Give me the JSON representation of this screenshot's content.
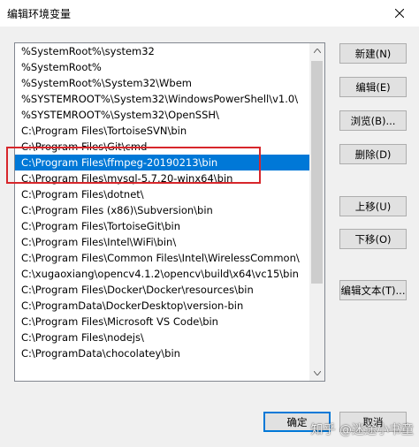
{
  "window": {
    "title": "编辑环境变量"
  },
  "list": {
    "items": [
      "%SystemRoot%\\system32",
      "%SystemRoot%",
      "%SystemRoot%\\System32\\Wbem",
      "%SYSTEMROOT%\\System32\\WindowsPowerShell\\v1.0\\",
      "%SYSTEMROOT%\\System32\\OpenSSH\\",
      "C:\\Program Files\\TortoiseSVN\\bin",
      "C:\\Program Files\\Git\\cmd",
      "C:\\Program Files\\ffmpeg-20190213\\bin",
      "C:\\Program Files\\mysql-5.7.20-winx64\\bin",
      "C:\\Program Files\\dotnet\\",
      "C:\\Program Files (x86)\\Subversion\\bin",
      "C:\\Program Files\\TortoiseGit\\bin",
      "C:\\Program Files\\Intel\\WiFi\\bin\\",
      "C:\\Program Files\\Common Files\\Intel\\WirelessCommon\\",
      "C:\\xugaoxiang\\opencv4.1.2\\opencv\\build\\x64\\vc15\\bin",
      "C:\\Program Files\\Docker\\Docker\\resources\\bin",
      "C:\\ProgramData\\DockerDesktop\\version-bin",
      "C:\\Program Files\\Microsoft VS Code\\bin",
      "C:\\Program Files\\nodejs\\",
      "C:\\ProgramData\\chocolatey\\bin"
    ],
    "selected_index": 7
  },
  "buttons": {
    "new": "新建(N)",
    "edit": "编辑(E)",
    "browse": "浏览(B)...",
    "delete": "删除(D)",
    "move_up": "上移(U)",
    "move_down": "下移(O)",
    "edit_text": "编辑文本(T)...",
    "ok": "确定",
    "cancel": "取消"
  },
  "watermark": {
    "text": "知乎 @迷途小书童"
  },
  "colors": {
    "selection": "#0078d7",
    "highlight_border": "#d7262b"
  },
  "icons": {
    "close": "close-icon",
    "scroll_up": "arrow-up-icon",
    "scroll_down": "arrow-down-icon"
  }
}
